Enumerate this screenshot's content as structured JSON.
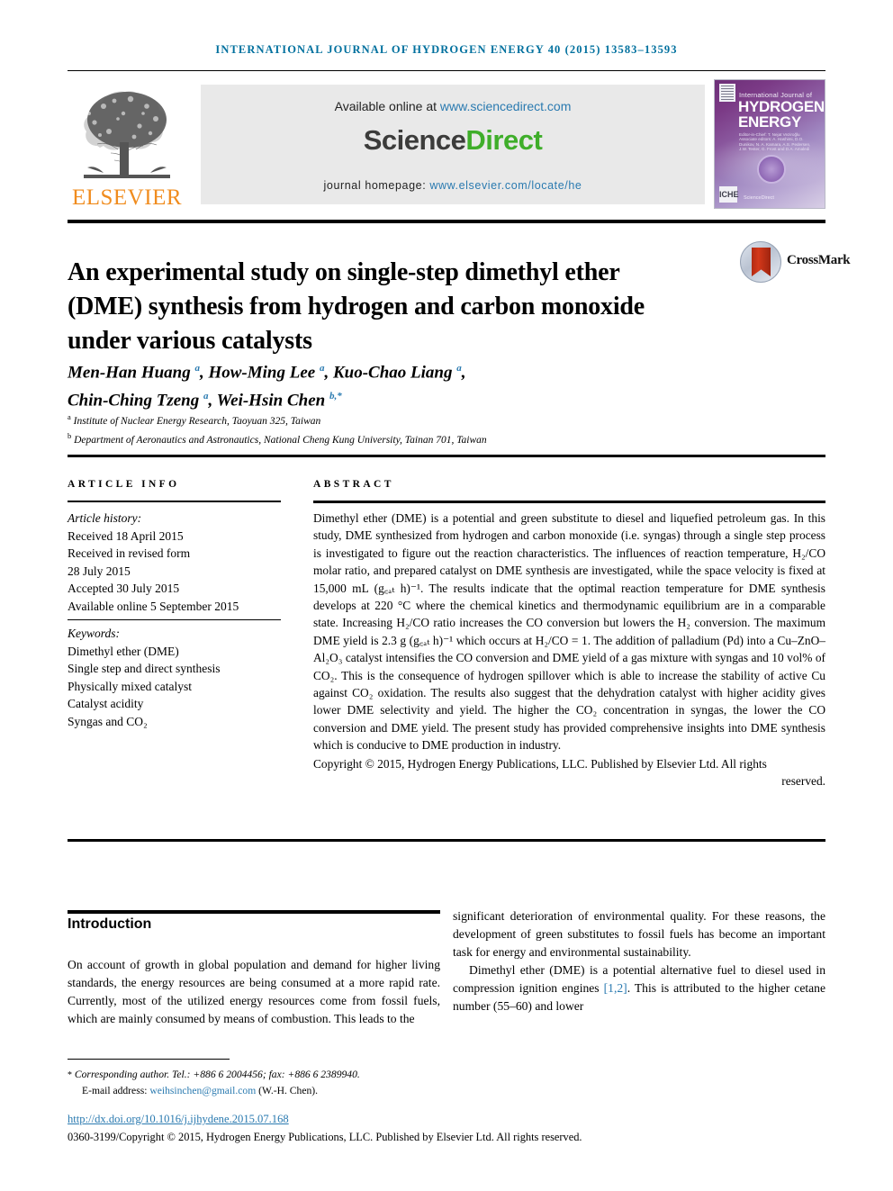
{
  "running_head": "International Journal of Hydrogen Energy 40 (2015) 13583–13593",
  "banner": {
    "publisher_name": "ELSEVIER",
    "available_prefix": "Available online at ",
    "available_link": "www.sciencedirect.com",
    "sciencedirect_part1": "Science",
    "sciencedirect_part2": "Direct",
    "homepage_prefix": "journal homepage: ",
    "homepage_link": "www.elsevier.com/locate/he",
    "cover": {
      "line_small": "International Journal of",
      "line_big_1": "HYDROGEN",
      "line_big_2": "ENERGY",
      "editors": "Editor-in-Chief: T. Nejat Veziroğlu   Associate editors: A. Hashimi, D.O. Dunikov, N. A. Kamara, A.S. Pedersen, J.W. Tester, G. Frost and D.A. Amaledi",
      "imprint": "ICHE",
      "sd_mark": "ScienceDirect"
    }
  },
  "article": {
    "title": "An experimental study on single-step dimethyl ether (DME) synthesis from hydrogen and carbon monoxide under various catalysts",
    "crossmark_label": "CrossMark",
    "authors_line1": "Men-Han Huang <sup>a</sup>, How-Ming Lee <sup>a</sup>, Kuo-Chao Liang <sup>a</sup>,",
    "authors_line2": "Chin-Ching Tzeng <sup>a</sup>, Wei-Hsin Chen <sup>b,*</sup>",
    "affiliation_a": "Institute of Nuclear Energy Research, Taoyuan 325, Taiwan",
    "affiliation_b": "Department of Aeronautics and Astronautics, National Cheng Kung University, Tainan 701, Taiwan"
  },
  "info": {
    "heading": "Article info",
    "history_label": "Article history:",
    "history": [
      "Received 18 April 2015",
      "Received in revised form",
      "28 July 2015",
      "Accepted 30 July 2015",
      "Available online 5 September 2015"
    ],
    "keywords_label": "Keywords:",
    "keywords": [
      "Dimethyl ether (DME)",
      "Single step and direct synthesis",
      "Physically mixed catalyst",
      "Catalyst acidity",
      "Syngas and CO₂"
    ]
  },
  "abstract": {
    "heading": "Abstract",
    "body": "Dimethyl ether (DME) is a potential and green substitute to diesel and liquefied petroleum gas. In this study, DME synthesized from hydrogen and carbon monoxide (i.e. syngas) through a single step process is investigated to figure out the reaction characteristics. The influences of reaction temperature, H₂/CO molar ratio, and prepared catalyst on DME synthesis are investigated, while the space velocity is fixed at 15,000 mL (g꜀ₐₜ h)⁻¹. The results indicate that the optimal reaction temperature for DME synthesis develops at 220 °C where the chemical kinetics and thermodynamic equilibrium are in a comparable state. Increasing H₂/CO ratio increases the CO conversion but lowers the H₂ conversion. The maximum DME yield is 2.3 g (g꜀ₐₜ h)⁻¹ which occurs at H₂/CO = 1. The addition of palladium (Pd) into a Cu–ZnO–Al₂O₃ catalyst intensifies the CO conversion and DME yield of a gas mixture with syngas and 10 vol% of CO₂. This is the consequence of hydrogen spillover which is able to increase the stability of active Cu against CO₂ oxidation. The results also suggest that the dehydration catalyst with higher acidity gives lower DME selectivity and yield. The higher the CO₂ concentration in syngas, the lower the CO conversion and DME yield. The present study has provided comprehensive insights into DME synthesis which is conducive to DME production in industry.",
    "copyright_main": "Copyright © 2015, Hydrogen Energy Publications, LLC. Published by Elsevier Ltd. All rights",
    "copyright_last": "reserved."
  },
  "body": {
    "section_title": "Introduction",
    "left_paragraph": "On account of growth in global population and demand for higher living standards, the energy resources are being consumed at a more rapid rate. Currently, most of the utilized energy resources come from fossil fuels, which are mainly consumed by means of combustion. This leads to the",
    "right_paragraph_1": "significant deterioration of environmental quality. For these reasons, the development of green substitutes to fossil fuels has become an important task for energy and environmental sustainability.",
    "right_paragraph_2a": "Dimethyl ether (DME) is a potential alternative fuel to diesel used in compression ignition engines ",
    "right_reference": "[1,2]",
    "right_paragraph_2b": ". This is attributed to the higher cetane number (55–60) and lower"
  },
  "footer": {
    "corresponding_star": "*",
    "corresponding_text": "Corresponding author. Tel.: +886 6 2004456; fax: +886 6 2389940.",
    "email_label": "E-mail address: ",
    "email": "weihsinchen@gmail.com",
    "email_owner": " (W.-H. Chen).",
    "doi": "http://dx.doi.org/10.1016/j.ijhydene.2015.07.168",
    "issn_line": "0360-3199/Copyright © 2015, Hydrogen Energy Publications, LLC. Published by Elsevier Ltd. All rights reserved."
  },
  "colors": {
    "link_blue": "#2a7ab0",
    "runhead_blue": "#00709e",
    "elsevier_orange": "#f08c1e",
    "sciencedirect_green": "#3fae2a",
    "crossmark_red": "#c4301a"
  }
}
